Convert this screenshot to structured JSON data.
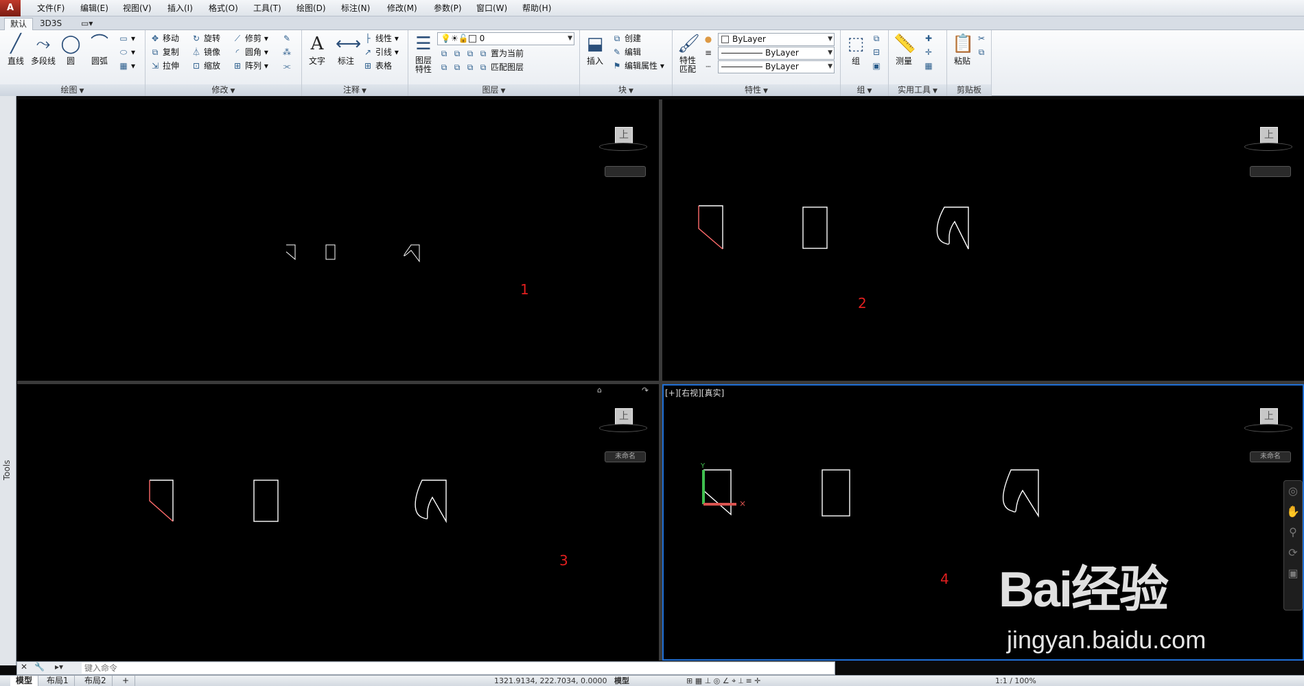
{
  "app": {
    "logo_text": "A"
  },
  "menu": [
    "文件(F)",
    "编辑(E)",
    "视图(V)",
    "插入(I)",
    "格式(O)",
    "工具(T)",
    "绘图(D)",
    "标注(N)",
    "修改(M)",
    "参数(P)",
    "窗口(W)",
    "帮助(H)"
  ],
  "ribbon_tabs": [
    "默认",
    "3D3S",
    "▭▾"
  ],
  "panels": {
    "draw": {
      "title": "绘图",
      "big": [
        "直线",
        "多段线",
        "圆",
        "圆弧"
      ]
    },
    "modify": {
      "title": "修改",
      "items": [
        "移动",
        "旋转",
        "修剪",
        "复制",
        "镜像",
        "圆角",
        "拉伸",
        "缩放",
        "阵列"
      ]
    },
    "annotate": {
      "title": "注释",
      "big": [
        "文字",
        "标注"
      ],
      "items": [
        "线性",
        "引线",
        "表格"
      ]
    },
    "layers": {
      "title": "图层",
      "big": "图层\n特性",
      "layer_value": "0",
      "items": [
        "置为当前",
        "匹配图层"
      ]
    },
    "block": {
      "title": "块",
      "big": "插入",
      "items": [
        "创建",
        "编辑",
        "编辑属性"
      ]
    },
    "properties": {
      "title": "特性",
      "big": "特性\n匹配",
      "color": "ByLayer",
      "linetype": "ByLayer",
      "lineweight": "ByLayer"
    },
    "groups": {
      "title": "组",
      "big": "组"
    },
    "utilities": {
      "title": "实用工具",
      "big": "测量"
    },
    "clipboard": {
      "title": "剪贴板",
      "big": "粘贴"
    }
  },
  "side_palette": {
    "label": "Tools"
  },
  "viewports": [
    {
      "number": "1",
      "label": "",
      "wcs": ""
    },
    {
      "number": "2",
      "label": "",
      "wcs": ""
    },
    {
      "number": "3",
      "label": "",
      "wcs": "未命名"
    },
    {
      "number": "4",
      "label": "[+][右视][真实]",
      "wcs": "未命名"
    }
  ],
  "viewcube_face": "上",
  "command_line": {
    "placeholder": "键入命令"
  },
  "layout_tabs": [
    "模型",
    "布局1",
    "布局2",
    "+"
  ],
  "status": {
    "coords": "1321.9134, 222.7034, 0.0000",
    "mode": "模型",
    "scale": "1:1 / 100%"
  },
  "watermark": {
    "logo": "Bai经验",
    "url": "jingyan.baidu.com"
  },
  "colors": {
    "viewport_bg": "#000000",
    "active_border": "#1f6fd6",
    "number_red": "#e21f1f",
    "ribbon_bg": "#f4f6f9"
  }
}
